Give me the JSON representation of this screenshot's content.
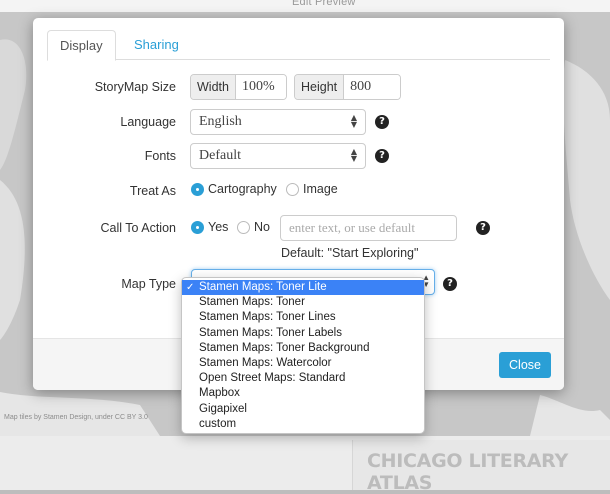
{
  "background": {
    "top_tabs": "Edit    Preview",
    "attribution": "Map tiles by Stamen Design, under CC BY 3.0",
    "atlas_title": "CHICAGO LITERARY ATLAS"
  },
  "tabs": [
    {
      "label": "Display",
      "active": true
    },
    {
      "label": "Sharing",
      "active": false
    }
  ],
  "form": {
    "storymap_size": {
      "label": "StoryMap Size",
      "width_label": "Width",
      "width_value": "100%",
      "height_label": "Height",
      "height_value": "800"
    },
    "language": {
      "label": "Language",
      "value": "English"
    },
    "fonts": {
      "label": "Fonts",
      "value": "Default"
    },
    "treat_as": {
      "label": "Treat As",
      "options": [
        "Cartography",
        "Image"
      ],
      "selected": "Cartography"
    },
    "call_to_action": {
      "label": "Call To Action",
      "options": [
        "Yes",
        "No"
      ],
      "selected": "Yes",
      "placeholder": "enter text, or use default",
      "default_hint": "Default: \"Start Exploring\""
    },
    "map_type": {
      "label": "Map Type",
      "selected": "Stamen Maps: Toner Lite",
      "options": [
        "Stamen Maps: Toner Lite",
        "Stamen Maps: Toner",
        "Stamen Maps: Toner Lines",
        "Stamen Maps: Toner Labels",
        "Stamen Maps: Toner Background",
        "Stamen Maps: Watercolor",
        "Open Street Maps: Standard",
        "Mapbox",
        "Gigapixel",
        "custom"
      ]
    }
  },
  "footer": {
    "close_label": "Close"
  },
  "icons": {
    "help": "?",
    "check": "✓",
    "select_arrows": "▲▼"
  },
  "colors": {
    "accent": "#2a9fd6",
    "selection": "#3b82f6"
  }
}
